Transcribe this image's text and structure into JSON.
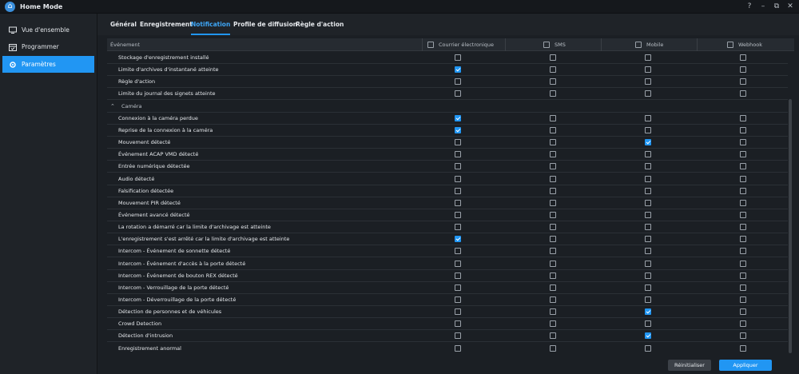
{
  "app": {
    "title": "Home Mode"
  },
  "window_controls": [
    "?",
    "–",
    "⧉",
    "✕"
  ],
  "sidebar": {
    "items": [
      {
        "label": "Vue d'ensemble",
        "icon": "monitor-icon",
        "active": false
      },
      {
        "label": "Programmer",
        "icon": "calendar-icon",
        "active": false
      },
      {
        "label": "Paramètres",
        "icon": "gear-icon",
        "active": true
      }
    ]
  },
  "tabs": [
    {
      "label": "Général",
      "active": false
    },
    {
      "label": "Enregistrement",
      "active": false
    },
    {
      "label": "Notification",
      "active": true
    },
    {
      "label": "Profile de diffusion",
      "active": false
    },
    {
      "label": "Règle d'action",
      "active": false
    }
  ],
  "table": {
    "headers": {
      "event": "Événement",
      "email": "Courrier électronique",
      "sms": "SMS",
      "mobile": "Mobile",
      "webhook": "Webhook"
    },
    "rows": [
      {
        "label": "Stockage d'enregistrement installé",
        "email": false,
        "sms": false,
        "mobile": false,
        "webhook": false
      },
      {
        "label": "Limite d'archives d'instantané atteinte",
        "email": true,
        "sms": false,
        "mobile": false,
        "webhook": false
      },
      {
        "label": "Règle d'action",
        "email": false,
        "sms": false,
        "mobile": false,
        "webhook": false
      },
      {
        "label": "Limite du journal des signets atteinte",
        "email": false,
        "sms": false,
        "mobile": false,
        "webhook": false
      },
      {
        "section": true,
        "label": "Caméra"
      },
      {
        "label": "Connexion à la caméra perdue",
        "email": true,
        "sms": false,
        "mobile": false,
        "webhook": false
      },
      {
        "label": "Reprise de la connexion à la caméra",
        "email": true,
        "sms": false,
        "mobile": false,
        "webhook": false
      },
      {
        "label": "Mouvement détecté",
        "email": false,
        "sms": false,
        "mobile": true,
        "webhook": false
      },
      {
        "label": "Événement ACAP VMD détecté",
        "email": false,
        "sms": false,
        "mobile": false,
        "webhook": false
      },
      {
        "label": "Entrée numérique détectée",
        "email": false,
        "sms": false,
        "mobile": false,
        "webhook": false
      },
      {
        "label": "Audio détecté",
        "email": false,
        "sms": false,
        "mobile": false,
        "webhook": false
      },
      {
        "label": "Falsification détectée",
        "email": false,
        "sms": false,
        "mobile": false,
        "webhook": false
      },
      {
        "label": "Mouvement PIR détecté",
        "email": false,
        "sms": false,
        "mobile": false,
        "webhook": false
      },
      {
        "label": "Événement avancé détecté",
        "email": false,
        "sms": false,
        "mobile": false,
        "webhook": false
      },
      {
        "label": "La rotation a démarré car la limite d'archivage est atteinte",
        "email": false,
        "sms": false,
        "mobile": false,
        "webhook": false
      },
      {
        "label": "L'enregistrement s'est arrêté car la limite d'archivage est atteinte",
        "email": true,
        "sms": false,
        "mobile": false,
        "webhook": false
      },
      {
        "label": "Intercom - Événement de sonnette détecté",
        "email": false,
        "sms": false,
        "mobile": false,
        "webhook": false
      },
      {
        "label": "Intercom - Événement d'accès à la porte détecté",
        "email": false,
        "sms": false,
        "mobile": false,
        "webhook": false
      },
      {
        "label": "Intercom - Événement de bouton REX détecté",
        "email": false,
        "sms": false,
        "mobile": false,
        "webhook": false
      },
      {
        "label": "Intercom - Verrouillage de la porte détecté",
        "email": false,
        "sms": false,
        "mobile": false,
        "webhook": false
      },
      {
        "label": "Intercom - Déverrouillage de la porte détecté",
        "email": false,
        "sms": false,
        "mobile": false,
        "webhook": false
      },
      {
        "label": "Détection de personnes et de véhicules",
        "email": false,
        "sms": false,
        "mobile": true,
        "webhook": false
      },
      {
        "label": "Crowd Detection",
        "email": false,
        "sms": false,
        "mobile": false,
        "webhook": false
      },
      {
        "label": "Détection d'intrusion",
        "email": false,
        "sms": false,
        "mobile": true,
        "webhook": false
      },
      {
        "label": "Enregistrement anormal",
        "email": false,
        "sms": false,
        "mobile": false,
        "webhook": false
      }
    ]
  },
  "footer": {
    "reset_label": "Réinitialiser",
    "apply_label": "Appliquer"
  },
  "colors": {
    "accent": "#2196f3",
    "background": "#1b1f24",
    "sidebar": "#1f2328"
  }
}
